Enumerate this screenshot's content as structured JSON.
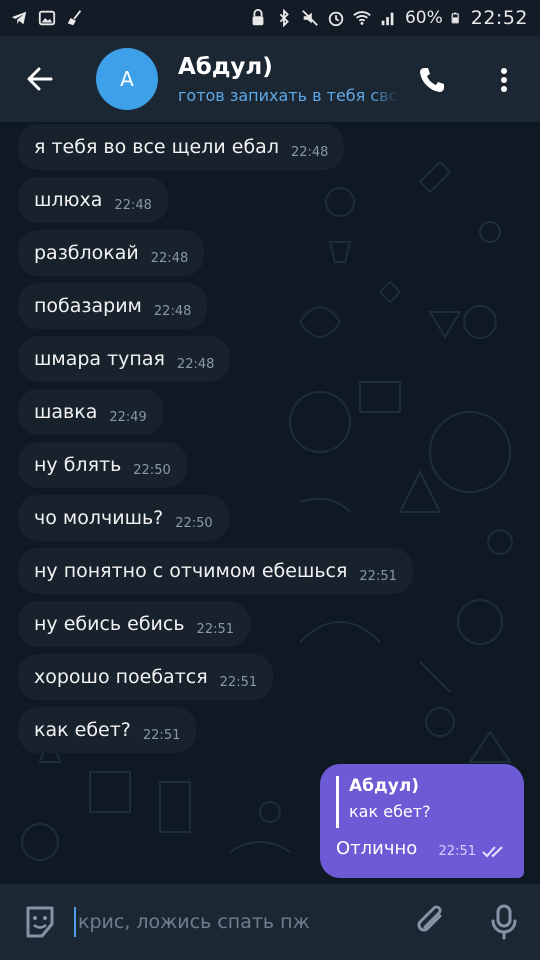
{
  "status_bar": {
    "battery": "60%",
    "time": "22:52"
  },
  "header": {
    "avatar_letter": "A",
    "name": "Абдул)",
    "status": "готов запихать в тебя свой"
  },
  "messages": [
    {
      "text": "я тебя во все щели ебал",
      "time": "22:48"
    },
    {
      "text": "шлюха",
      "time": "22:48"
    },
    {
      "text": "разблокай",
      "time": "22:48"
    },
    {
      "text": "побазарим",
      "time": "22:48"
    },
    {
      "text": "шмара тупая",
      "time": "22:48"
    },
    {
      "text": "шавка",
      "time": "22:49"
    },
    {
      "text": "ну блять",
      "time": "22:50"
    },
    {
      "text": "чо молчишь?",
      "time": "22:50"
    },
    {
      "text": "ну понятно с отчимом ебешься",
      "time": "22:51"
    },
    {
      "text": "ну ебись ебись",
      "time": "22:51"
    },
    {
      "text": "хорошо поебатся",
      "time": "22:51"
    },
    {
      "text": "как ебет?",
      "time": "22:51"
    }
  ],
  "outgoing": {
    "reply_name": "Абдул)",
    "reply_text": "как ебет?",
    "text": "Отлично",
    "time": "22:51"
  },
  "input": {
    "text": "крис, ложись спать пж"
  },
  "colors": {
    "background": "#0e1621",
    "header": "#1c2734",
    "incoming_bubble": "#18222d",
    "outgoing_bubble": "#6d5bd6",
    "accent": "#3ea0e8"
  }
}
